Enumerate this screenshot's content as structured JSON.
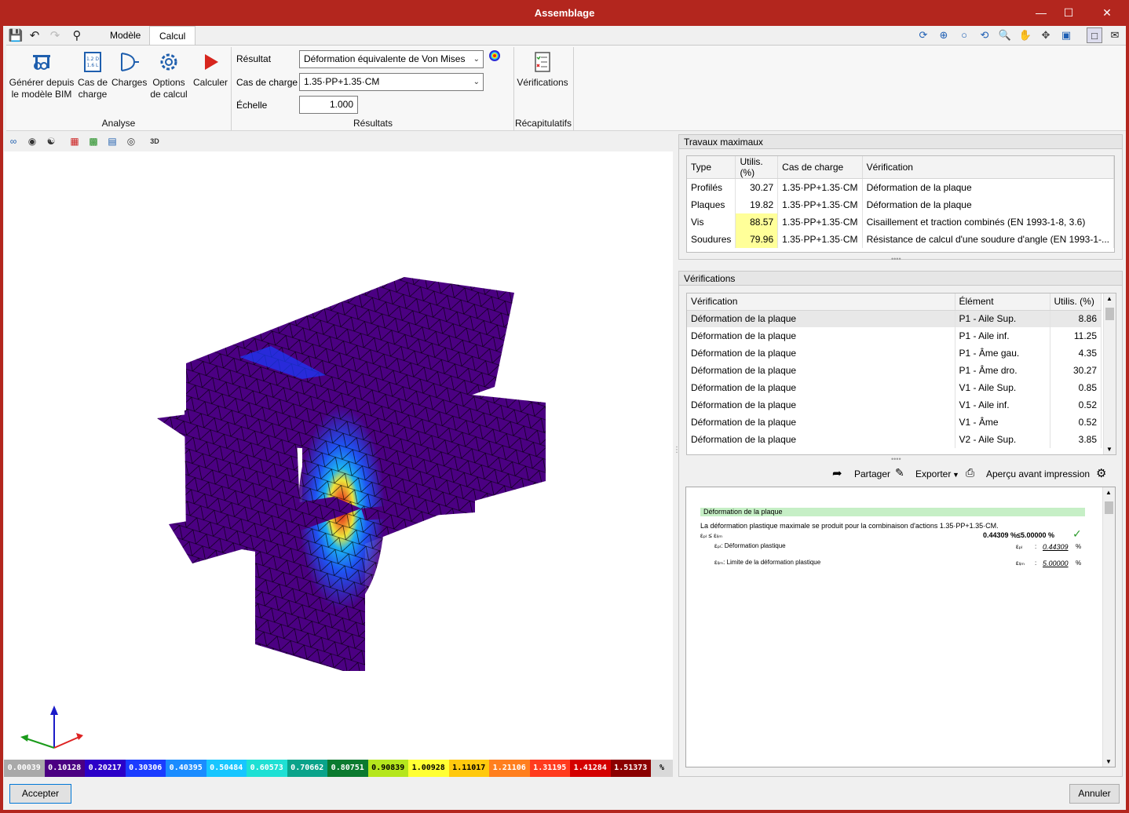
{
  "window": {
    "title": "Assemblage"
  },
  "tabs": [
    {
      "label": "Modèle"
    },
    {
      "label": "Calcul"
    }
  ],
  "ribbon": {
    "analyse": {
      "group_label": "Analyse",
      "buttons": [
        {
          "label1": "Générer depuis",
          "label2": "le modèle BIM"
        },
        {
          "label1": "Cas de",
          "label2": "charge"
        },
        {
          "label1": "Charges",
          "label2": ""
        },
        {
          "label1": "Options",
          "label2": "de calcul"
        },
        {
          "label1": "Calculer",
          "label2": ""
        }
      ]
    },
    "resultats": {
      "group_label": "Résultats",
      "resultat_label": "Résultat",
      "resultat_value": "Déformation équivalente de Von Mises",
      "cas_label": "Cas de charge",
      "cas_value": "1.35·PP+1.35·CM",
      "echelle_label": "Échelle",
      "echelle_value": "1.000"
    },
    "recap": {
      "group_label": "Récapitulatifs",
      "verif_label": "Vérifications"
    }
  },
  "legend": {
    "values": [
      "0.00039",
      "0.10128",
      "0.20217",
      "0.30306",
      "0.40395",
      "0.50484",
      "0.60573",
      "0.70662",
      "0.80751",
      "0.90839",
      "1.00928",
      "1.11017",
      "1.21106",
      "1.31195",
      "1.41284",
      "1.51373"
    ],
    "colors": [
      "#a9a9a9",
      "#4b0082",
      "#2b00c8",
      "#1a3cff",
      "#1a8cff",
      "#17c6ff",
      "#1ee0d4",
      "#0aa38a",
      "#0b7a2f",
      "#b5e61d",
      "#ffff33",
      "#ffc90e",
      "#ff7f1e",
      "#ff3b1e",
      "#d40000",
      "#8b0000"
    ],
    "unit": "%"
  },
  "travaux": {
    "title": "Travaux maximaux",
    "headers": [
      "Type",
      "Utilis. (%)",
      "Cas de charge",
      "Vérification"
    ],
    "rows": [
      [
        "Profilés",
        "30.27",
        "1.35·PP+1.35·CM",
        "Déformation de la plaque"
      ],
      [
        "Plaques",
        "19.82",
        "1.35·PP+1.35·CM",
        "Déformation de la plaque"
      ],
      [
        "Vis",
        "88.57",
        "1.35·PP+1.35·CM",
        "Cisaillement et traction combinés (EN 1993-1-8, 3.6)"
      ],
      [
        "Soudures",
        "79.96",
        "1.35·PP+1.35·CM",
        "Résistance de calcul d'une soudure d'angle (EN 1993-1-..."
      ]
    ]
  },
  "verifications": {
    "title": "Vérifications",
    "headers": [
      "Vérification",
      "Élément",
      "Utilis. (%)"
    ],
    "rows": [
      [
        "Déformation de la plaque",
        "P1 - Aile Sup.",
        "8.86"
      ],
      [
        "Déformation de la plaque",
        "P1 - Aile inf.",
        "11.25"
      ],
      [
        "Déformation de la plaque",
        "P1 - Âme gau.",
        "4.35"
      ],
      [
        "Déformation de la plaque",
        "P1 - Âme dro.",
        "30.27"
      ],
      [
        "Déformation de la plaque",
        "V1 - Aile Sup.",
        "0.85"
      ],
      [
        "Déformation de la plaque",
        "V1 - Aile inf.",
        "0.52"
      ],
      [
        "Déformation de la plaque",
        "V1 - Âme",
        "0.52"
      ],
      [
        "Déformation de la plaque",
        "V2 - Aile Sup.",
        "3.85"
      ]
    ]
  },
  "actions": {
    "share": "Partager",
    "export": "Exporter",
    "preview": "Aperçu avant impression"
  },
  "report": {
    "heading": "Déformation de la plaque",
    "sentence": "La déformation plastique maximale se produit pour la combinaison d'actions 1.35·PP+1.35·CM.",
    "check_lhs": "εₚₗ ≤ εₗᵢₘ",
    "check_value": "0.44309 %≤5.00000 %",
    "line1_label": "εₚₗ: Déformation plastique",
    "line1_sym": "εₚₗ",
    "line1_value": "0.44309",
    "line2_label": "εₗᵢₘ: Limite de la déformation plastique",
    "line2_sym": "εₗᵢₘ",
    "line2_value": "5.00000",
    "unit": "%"
  },
  "footer": {
    "accept": "Accepter",
    "cancel": "Annuler"
  }
}
